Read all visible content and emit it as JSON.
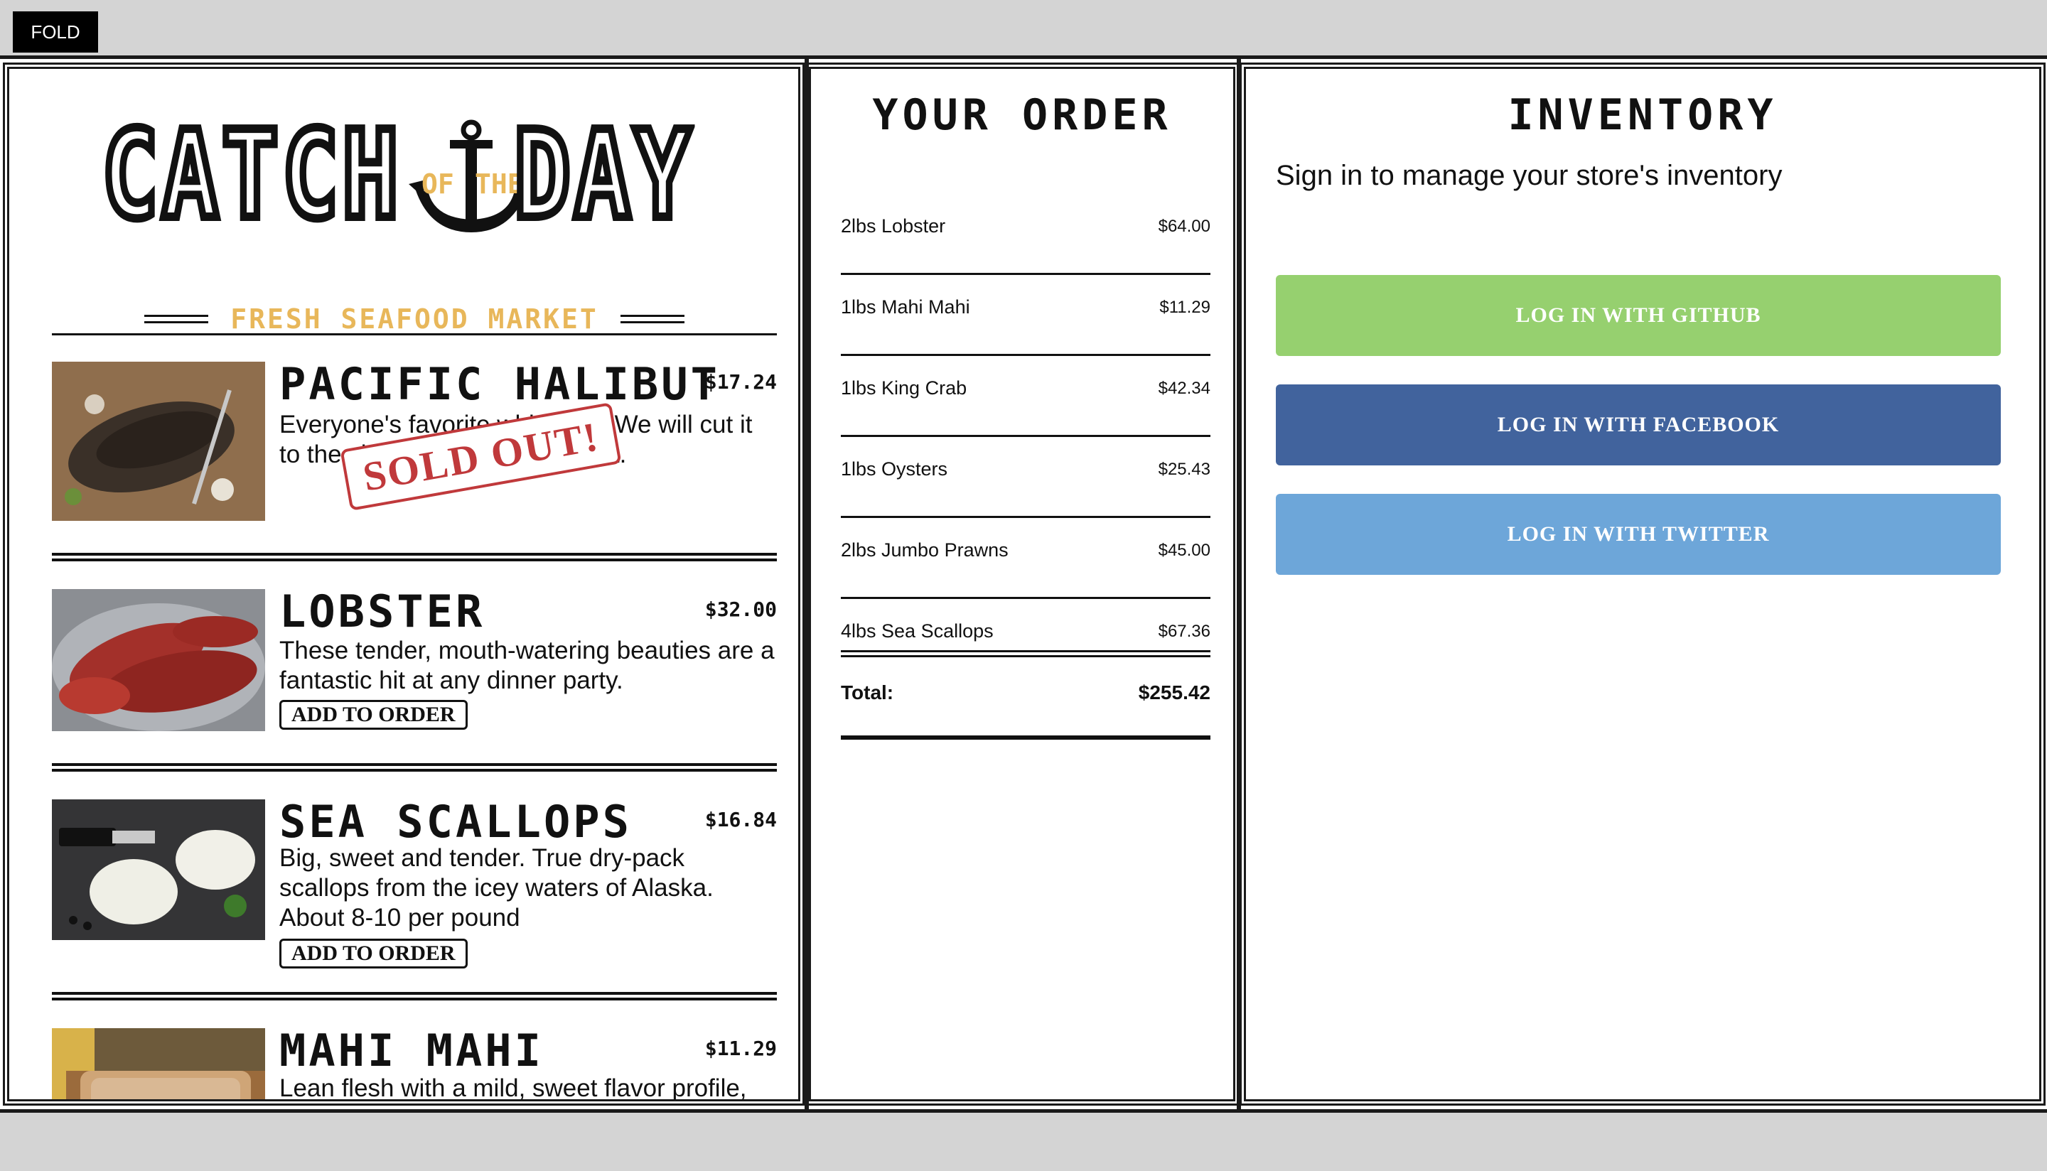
{
  "fold_button": "FOLD",
  "menu": {
    "logo": {
      "word1": "CATCH",
      "of": "OF",
      "the": "THE",
      "word2": "DAY",
      "tagline": "FRESH SEAFOOD MARKET",
      "anchor_icon": "anchor-icon",
      "accent_color": "#e8b75a"
    },
    "fishes": [
      {
        "name": "PACIFIC HALIBUT",
        "price": "$17.24",
        "desc": "Everyone's favorite white fish. We will cut it to the size you want and ship it.",
        "status": "SOLD OUT!",
        "image": "halibut-photo"
      },
      {
        "name": "LOBSTER",
        "price": "$32.00",
        "desc": "These tender, mouth-watering beauties are a fantastic hit at any dinner party.",
        "button": "ADD TO ORDER",
        "image": "lobster-photo"
      },
      {
        "name": "SEA SCALLOPS",
        "price": "$16.84",
        "desc": "Big, sweet and tender. True dry-pack scallops from the icey waters of Alaska. About 8-10 per pound",
        "button": "ADD TO ORDER",
        "image": "scallops-photo"
      },
      {
        "name": "MAHI MAHI",
        "price": "$11.29",
        "desc": "Lean flesh with a mild, sweet flavor profile, moderately firm texture and large, moist flakes.",
        "image": "mahi-photo"
      }
    ]
  },
  "order": {
    "title": "YOUR ORDER",
    "items": [
      {
        "name": "2lbs Lobster",
        "amount": "$64.00"
      },
      {
        "name": "1lbs Mahi Mahi",
        "amount": "$11.29"
      },
      {
        "name": "1lbs King Crab",
        "amount": "$42.34"
      },
      {
        "name": "1lbs Oysters",
        "amount": "$25.43"
      },
      {
        "name": "2lbs Jumbo Prawns",
        "amount": "$45.00"
      },
      {
        "name": "4lbs Sea Scallops",
        "amount": "$67.36"
      }
    ],
    "total_label": "Total:",
    "total_value": "$255.42"
  },
  "inventory": {
    "title": "INVENTORY",
    "subtitle": "Sign in to manage your store's inventory",
    "buttons": {
      "github": "LOG IN WITH GITHUB",
      "facebook": "LOG IN WITH FACEBOOK",
      "twitter": "LOG IN WITH TWITTER"
    },
    "colors": {
      "github": "#96d06f",
      "facebook": "#41639d",
      "twitter": "#6da6d9"
    }
  }
}
